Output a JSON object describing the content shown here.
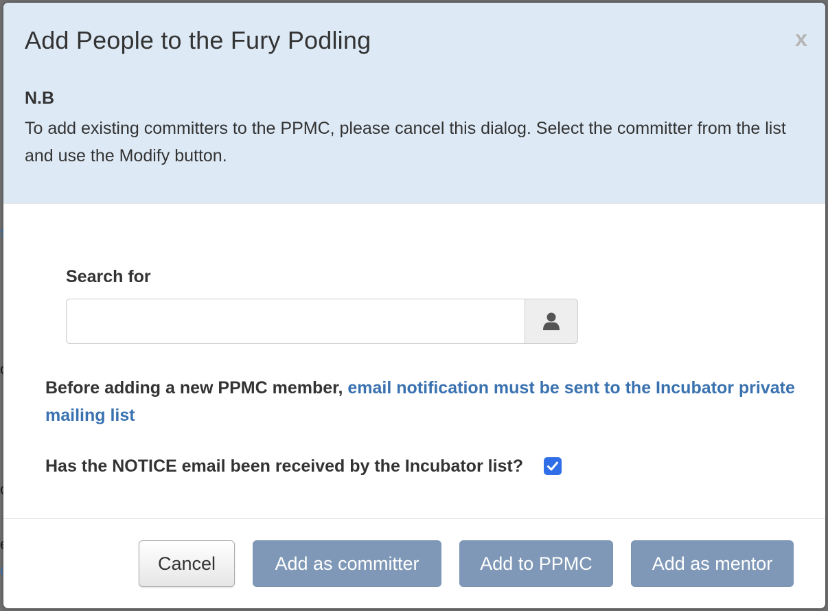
{
  "dialog": {
    "title": "Add People to the Fury Podling",
    "close_label": "x",
    "nb_heading": "N.B",
    "nb_text": "To add existing committers to the PPMC, please cancel this dialog. Select the committer from the list and use the Modify button."
  },
  "search": {
    "label": "Search for",
    "value": "",
    "placeholder": "",
    "addon_icon": "user-icon"
  },
  "notice": {
    "prefix": "Before adding a new PPMC member, ",
    "link_text": "email notification must be sent to the Incubator private mailing list",
    "question": "Has the NOTICE email been received by the Incubator list?",
    "checked": true
  },
  "buttons": {
    "cancel": "Cancel",
    "add_committer": "Add as committer",
    "add_ppmc": "Add to PPMC",
    "add_mentor": "Add as mentor"
  },
  "colors": {
    "header_bg": "#dde9f5",
    "link": "#3a72b0",
    "primary_button": "#7f98b7",
    "checkbox": "#2f6ee6"
  }
}
